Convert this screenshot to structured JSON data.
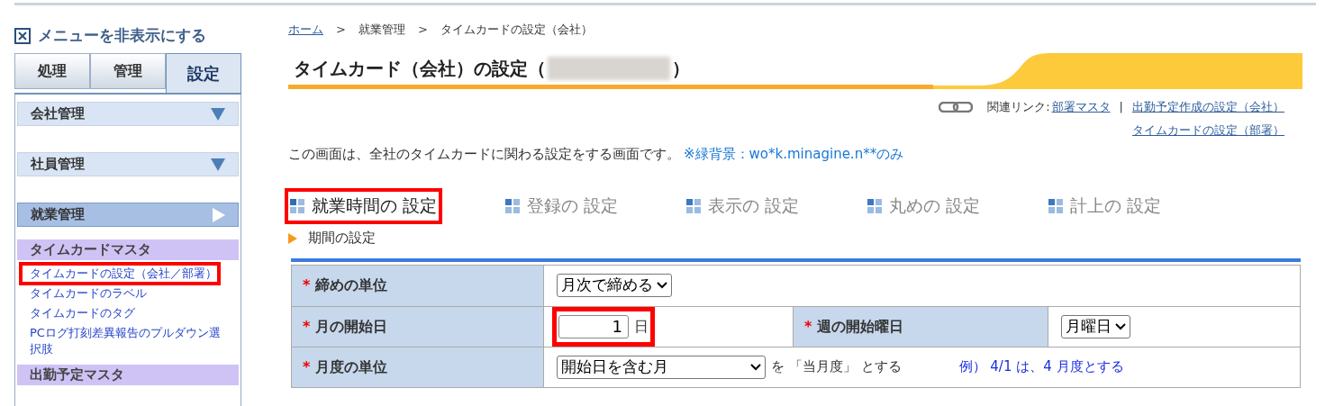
{
  "sidebar": {
    "hide_menu": "メニューを非表示にする",
    "tabs": [
      {
        "label": "処理",
        "selected": false
      },
      {
        "label": "管理",
        "selected": false
      },
      {
        "label": "設定",
        "selected": true
      }
    ],
    "sections": [
      {
        "label": "会社管理",
        "expanded": false
      },
      {
        "label": "社員管理",
        "expanded": false
      },
      {
        "label": "就業管理",
        "expanded": true
      }
    ],
    "groups": [
      {
        "title": "タイムカードマスタ",
        "links": [
          {
            "label": "タイムカードの設定（会社／部署）",
            "highlighted": true
          },
          {
            "label": "タイムカードのラベル",
            "highlighted": false
          },
          {
            "label": "タイムカードのタグ",
            "highlighted": false
          },
          {
            "label": "PCログ打刻差異報告のプルダウン選択肢",
            "highlighted": false
          }
        ]
      },
      {
        "title": "出勤予定マスタ"
      }
    ]
  },
  "breadcrumb": {
    "separators": [
      ">",
      ">"
    ],
    "items": [
      {
        "label": "ホーム",
        "kind": "link"
      },
      {
        "label": "就業管理",
        "kind": "text"
      },
      {
        "label": "タイムカードの設定（会社）",
        "kind": "text"
      }
    ]
  },
  "title": {
    "text_before": "タイムカード（会社）の設定（",
    "redacted": true,
    "text_after": "）"
  },
  "related": {
    "label": "関連リンク:",
    "separator": "|",
    "links": [
      "部署マスタ",
      "出勤予定作成の設定（会社）",
      "タイムカードの設定（部署）"
    ]
  },
  "description": {
    "text": "この画面は、全社のタイムカードに関わる設定をする画面です。",
    "note": "※緑背景：wo*k.minagine.n**のみ"
  },
  "section_tabs": [
    {
      "label": "就業時間の 設定",
      "selected": true,
      "highlighted": true
    },
    {
      "label": "登録の 設定",
      "selected": false,
      "highlighted": false
    },
    {
      "label": "表示の 設定",
      "selected": false,
      "highlighted": false
    },
    {
      "label": "丸めの 設定",
      "selected": false,
      "highlighted": false
    },
    {
      "label": "計上の 設定",
      "selected": false,
      "highlighted": false
    }
  ],
  "subsection": "期間の設定",
  "form": {
    "rows": [
      {
        "cells": [
          {
            "kind": "label",
            "mark": "*",
            "text": "締めの単位"
          },
          {
            "kind": "select",
            "value": "月次で締める"
          }
        ]
      },
      {
        "cells": [
          {
            "kind": "label",
            "mark": "*",
            "text": "月の開始日"
          },
          {
            "kind": "input",
            "value": "1",
            "unit": "日",
            "highlighted": true
          },
          {
            "kind": "label",
            "mark": "*",
            "text": "週の開始曜日"
          },
          {
            "kind": "select",
            "value": "月曜日"
          }
        ]
      },
      {
        "cells": [
          {
            "kind": "label",
            "mark": "*",
            "text": "月度の単位"
          },
          {
            "kind": "select",
            "value": "開始日を含む月",
            "suffix": "を 「当月度」 とする",
            "example": "例） 4/1 は、4 月度とする"
          }
        ]
      }
    ]
  }
}
